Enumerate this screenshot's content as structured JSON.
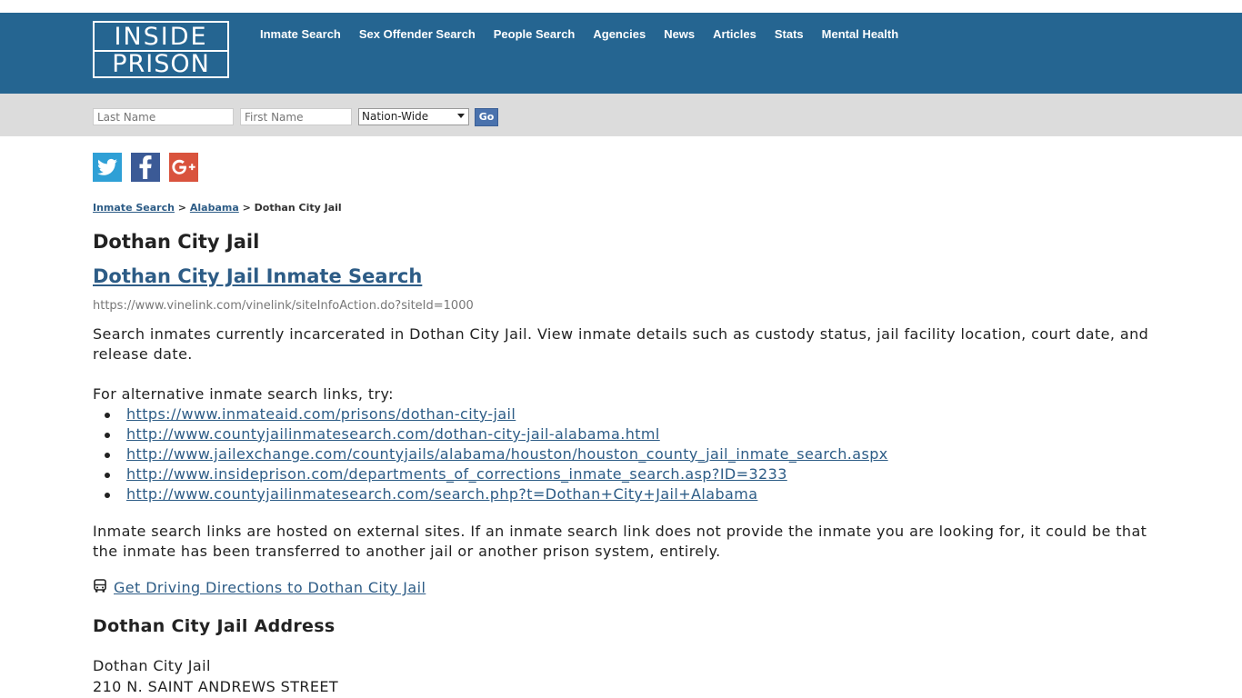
{
  "brand": {
    "line1": "INSIDE",
    "line2": "PRISON"
  },
  "nav": {
    "items": [
      "Inmate Search",
      "Sex Offender Search",
      "People Search",
      "Agencies",
      "News",
      "Articles",
      "Stats",
      "Mental Health"
    ]
  },
  "search": {
    "last_name_placeholder": "Last Name",
    "first_name_placeholder": "First Name",
    "scope_selected": "Nation-Wide",
    "go_label": "Go"
  },
  "social": [
    "twitter-icon",
    "facebook-icon",
    "google-plus-icon"
  ],
  "breadcrumb": {
    "items": [
      "Inmate Search",
      "Alabama"
    ],
    "separator": ">",
    "current": "Dothan City Jail"
  },
  "page": {
    "title": "Dothan City Jail",
    "search_link": "Dothan City Jail Inmate Search",
    "search_url": "https://www.vinelink.com/vinelink/siteInfoAction.do?siteId=1000",
    "description": "Search inmates currently incarcerated in Dothan City Jail. View inmate details such as custody status, jail facility location, court date, and release date.",
    "alt_intro": "For alternative inmate search links, try:",
    "alt_links": [
      "https://www.inmateaid.com/prisons/dothan-city-jail",
      "http://www.countyjailinmatesearch.com/dothan-city-jail-alabama.html",
      "http://www.jailexchange.com/countyjails/alabama/houston/houston_county_jail_inmate_search.aspx",
      "http://www.insideprison.com/departments_of_corrections_inmate_search.asp?ID=3233",
      "http://www.countyjailinmatesearch.com/search.php?t=Dothan+City+Jail+Alabama"
    ],
    "disclaimer": "Inmate search links are hosted on external sites. If an inmate search link does not provide the inmate you are looking for, it could be that the inmate has been transferred to another jail or another prison system, entirely.",
    "directions_link": "Get Driving Directions to Dothan City Jail",
    "address_heading": "Dothan City Jail Address",
    "address_lines": [
      "Dothan City Jail",
      "210 N. SAINT ANDREWS STREET"
    ]
  },
  "colors": {
    "header_bg": "#256591",
    "search_bg": "#dcdcdc",
    "link": "#2d5c86",
    "go_button": "#4a72ad"
  }
}
